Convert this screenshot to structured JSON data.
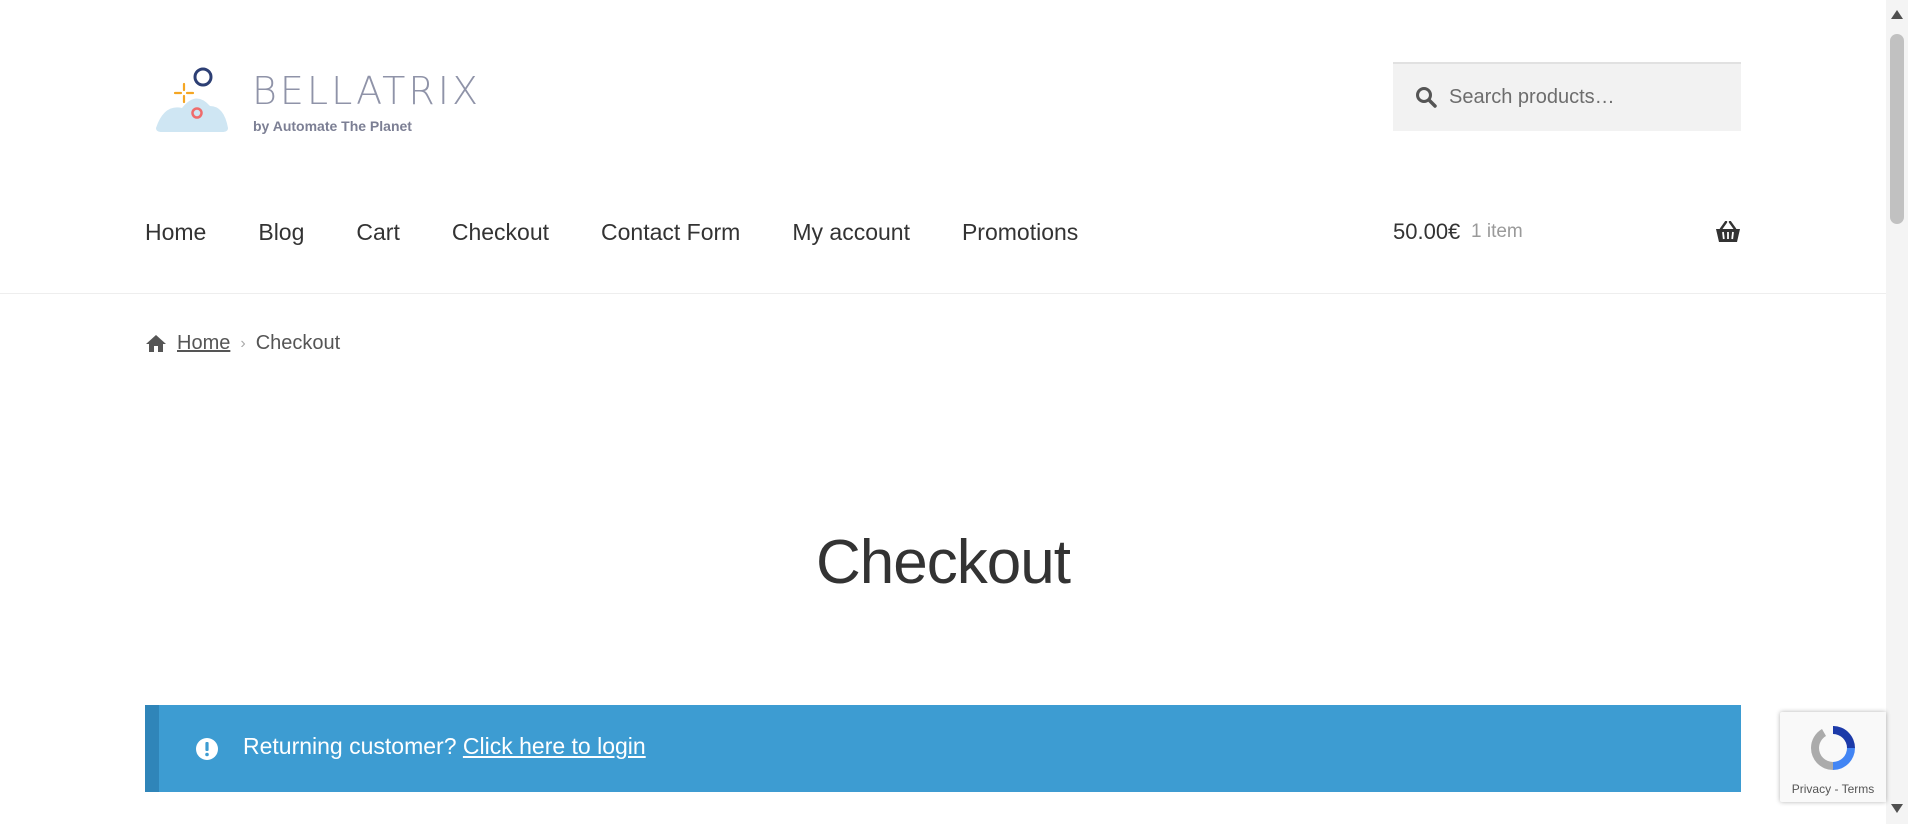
{
  "brand": {
    "name": "BELLATRIX",
    "tagline": "by Automate The Planet",
    "colors": {
      "navy": "#2d3f74",
      "orange": "#f5a623",
      "coral": "#ef6c6c",
      "sky": "#cfe6f3",
      "text": "#8f93a8"
    }
  },
  "search": {
    "placeholder": "Search products…",
    "icon": "search-icon"
  },
  "nav": {
    "items": [
      {
        "label": "Home"
      },
      {
        "label": "Blog"
      },
      {
        "label": "Cart"
      },
      {
        "label": "Checkout"
      },
      {
        "label": "Contact Form"
      },
      {
        "label": "My account"
      },
      {
        "label": "Promotions"
      }
    ]
  },
  "cart": {
    "amount": "50.00€",
    "count": "1 item",
    "icon": "basket-icon"
  },
  "breadcrumb": {
    "home": "Home",
    "current": "Checkout",
    "icon": "home-icon"
  },
  "page": {
    "title": "Checkout"
  },
  "notice": {
    "text": "Returning customer?",
    "link": "Click here to login",
    "color": "#3d9cd2",
    "icon": "info-icon"
  },
  "recaptcha": {
    "privacy": "Privacy",
    "separator": " - ",
    "terms": "Terms"
  }
}
